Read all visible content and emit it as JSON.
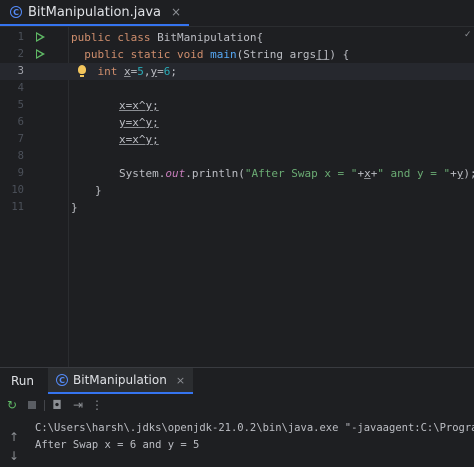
{
  "editor_tab": {
    "label": "BitManipulation.java",
    "icon": "class-icon",
    "close": "×"
  },
  "lines": [
    {
      "num": "1"
    },
    {
      "num": "2"
    },
    {
      "num": "3"
    },
    {
      "num": "4"
    },
    {
      "num": "5"
    },
    {
      "num": "6"
    },
    {
      "num": "7"
    },
    {
      "num": "8"
    },
    {
      "num": "9"
    },
    {
      "num": "10"
    },
    {
      "num": "11"
    }
  ],
  "code": {
    "l1": {
      "kw1": "public",
      "kw2": "class",
      "name": "BitManipulation{"
    },
    "l2": {
      "kw1": "public",
      "kw2": "static",
      "kw3": "void",
      "fn": "main",
      "params": "(String args",
      "brackets": "[]",
      "rest": ") {"
    },
    "l3": {
      "kw": "int",
      "x": "x",
      "eq1": "=",
      "five": "5",
      "comma": ",",
      "y": "y",
      "eq2": "=",
      "six": "6",
      "semi": ";"
    },
    "l5": "x=x^y;",
    "l6": "y=x^y;",
    "l7": "x=x^y;",
    "l9": {
      "sys": "System.",
      "out": "out",
      "println": ".println(",
      "s1": "\"After Swap x = \"",
      "p1": "+",
      "xv": "x",
      "p2": "+",
      "s2": "\" and y = \"",
      "p3": "+",
      "yv": "y",
      "end": ");"
    },
    "l10": "}",
    "l11": "}"
  },
  "panel": {
    "run_label": "Run",
    "tab_label": "BitManipulation",
    "tab_close": "×",
    "console_lines": [
      "C:\\Users\\harsh\\.jdks\\openjdk-21.0.2\\bin\\java.exe \"-javaagent:C:\\Program F",
      "After Swap x = 6 and y = 5"
    ]
  },
  "colors": {
    "keyword": "#cf8e6d",
    "function": "#56a8f5",
    "number": "#2aacb8",
    "string": "#6aab73",
    "field": "#c77dbb",
    "accent": "#3574f0"
  }
}
